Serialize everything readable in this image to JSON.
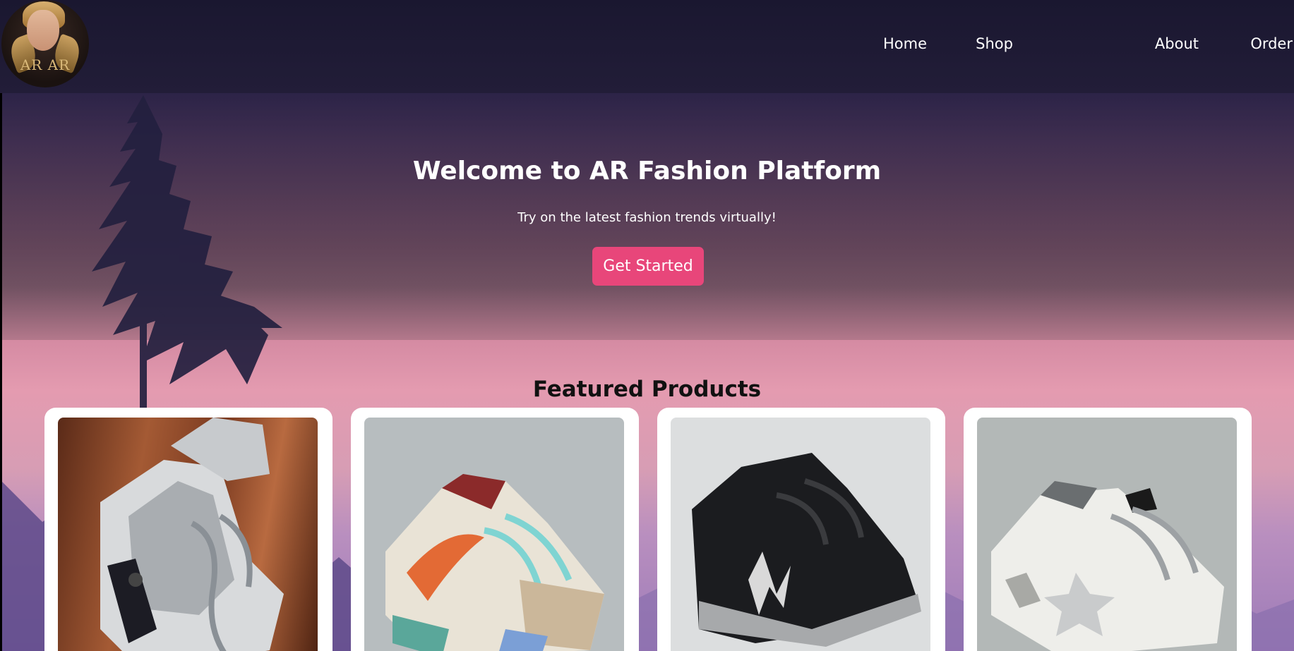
{
  "header": {
    "logo_text": "AR AR",
    "nav": [
      {
        "label": "Home"
      },
      {
        "label": "Shop"
      },
      {
        "label": "About"
      },
      {
        "label": "Order"
      }
    ]
  },
  "hero": {
    "title": "Welcome to AR Fashion Platform",
    "subtitle": "Try on the latest fashion trends virtually!",
    "cta_label": "Get Started"
  },
  "featured": {
    "title": "Featured Products",
    "products": [
      {
        "image": "grey-white-high-top-sneakers",
        "background": "#8a4a2a"
      },
      {
        "image": "multicolor-low-top-sneakers",
        "background": "#b7bdbf"
      },
      {
        "image": "black-new-balance-sneakers",
        "background": "#d9dbdc"
      },
      {
        "image": "white-distressed-star-sneakers",
        "background": "#b2b7b6"
      }
    ]
  },
  "colors": {
    "accent": "#e8467a",
    "header_bg": "#1d1a33",
    "card_bg": "#ffffff"
  }
}
